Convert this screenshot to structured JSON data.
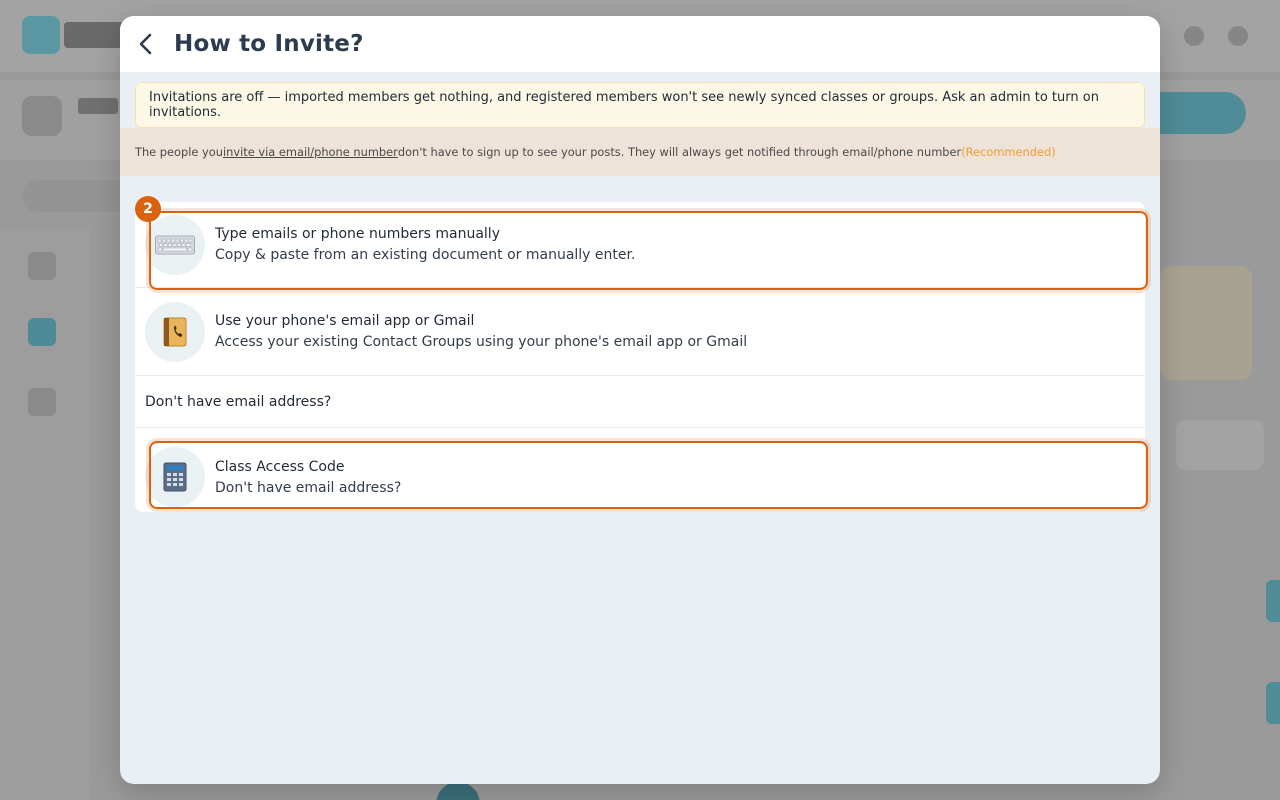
{
  "modal": {
    "title": "How to Invite?",
    "warning": "Invitations are off — imported members get nothing, and registered members won't see newly synced classes or groups. Ask an admin to turn on invitations.",
    "info": {
      "prefix": "The people you ",
      "link": "invite via email/phone number ",
      "suffix": "don't have to sign up to see your posts. They will always get notified through email/phone number ",
      "recommended": "(Recommended)"
    },
    "options": [
      {
        "title": "Type emails or phone numbers manually",
        "subtitle": "Copy & paste from an existing document or manually enter.",
        "icon": "keyboard-icon"
      },
      {
        "title": "Use your phone's email app or Gmail",
        "subtitle": "Access your existing Contact Groups using your phone's email app or Gmail",
        "icon": "address-book-icon"
      }
    ],
    "no_email_header": "Don't have email address?",
    "access_code": {
      "title": "Class Access Code",
      "subtitle": "Don't have email address?",
      "icon": "calculator-icon"
    }
  },
  "step_badge": "2",
  "colors": {
    "highlight": "#d9630f",
    "recommended": "#f39c33",
    "warning_bg": "#fdf8e6",
    "info_bg": "#ede3d8"
  }
}
